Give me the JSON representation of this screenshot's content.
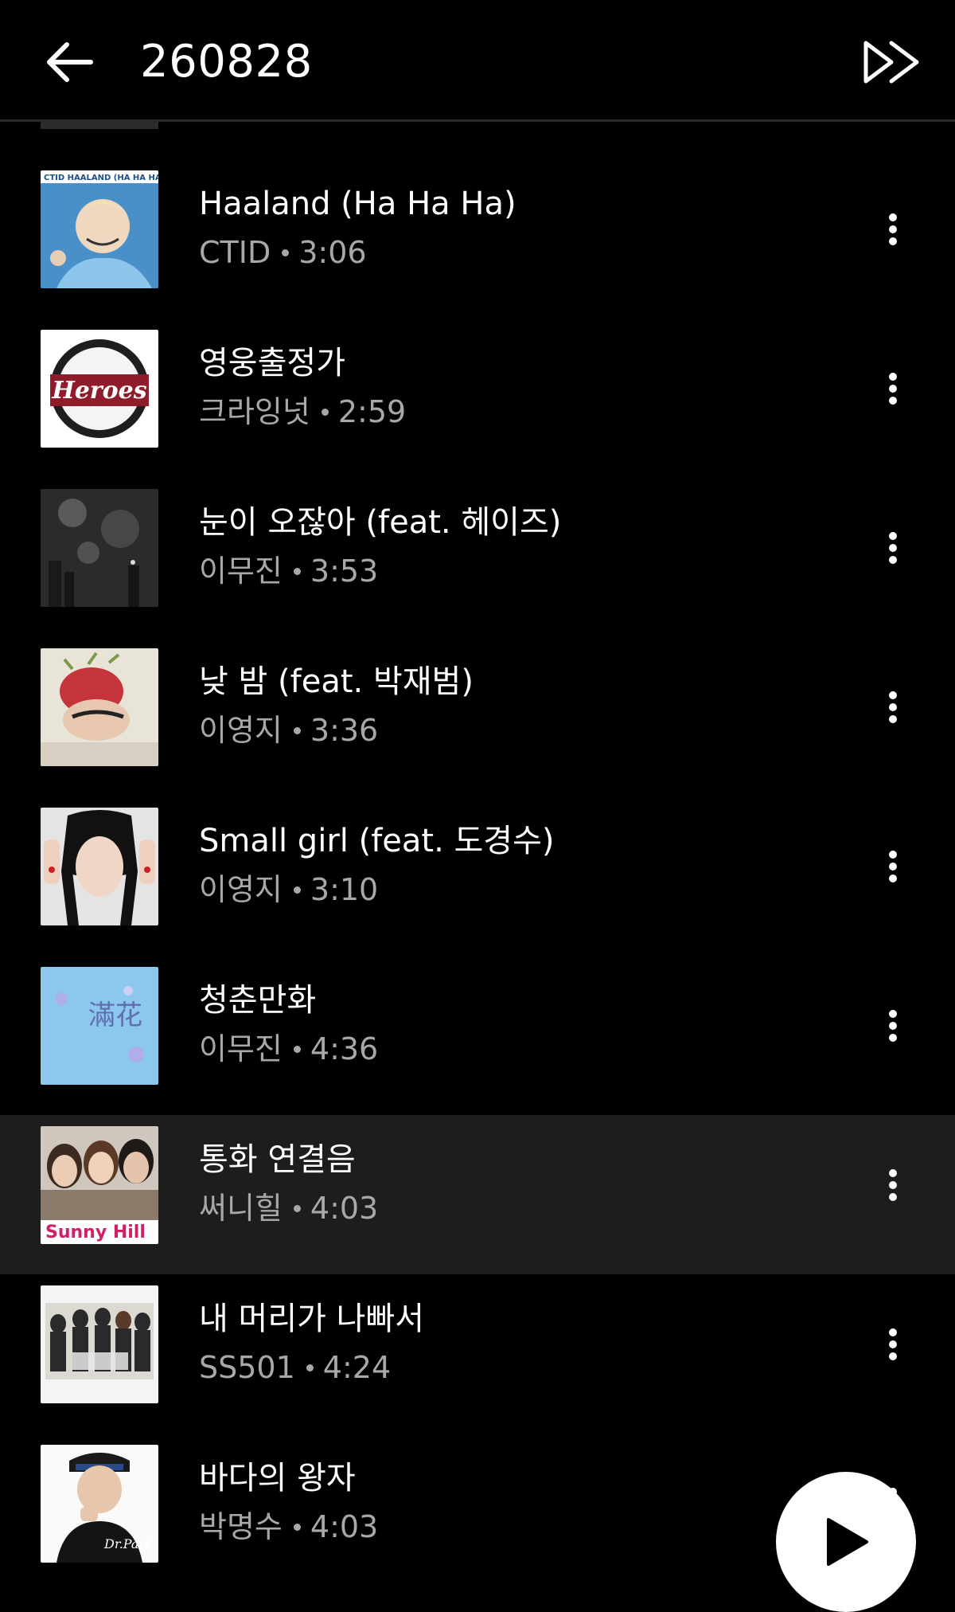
{
  "header": {
    "title": "260828",
    "back_icon": "arrow-left-icon",
    "skip_icon": "double-chevron-right-icon"
  },
  "songs": [
    {
      "title": "Haaland (Ha Ha Ha)",
      "artist": "CTID",
      "duration": "3:06",
      "cover_text": "CTID HAALAND (HA HA HA)"
    },
    {
      "title": "영웅출정가",
      "artist": "크라잉넛",
      "duration": "2:59",
      "cover_text": "Heroes"
    },
    {
      "title": "눈이 오잖아 (feat. 헤이즈)",
      "artist": "이무진",
      "duration": "3:53"
    },
    {
      "title": "낮 밤 (feat. 박재범)",
      "artist": "이영지",
      "duration": "3:36"
    },
    {
      "title": "Small girl (feat. 도경수)",
      "artist": "이영지",
      "duration": "3:10"
    },
    {
      "title": "청춘만화",
      "artist": "이무진",
      "duration": "4:36",
      "cover_text": "滿花"
    },
    {
      "title": "통화 연결음",
      "artist": "써니힐",
      "duration": "4:03",
      "cover_text": "Sunny Hill",
      "highlighted": true
    },
    {
      "title": "내 머리가 나빠서",
      "artist": "SS501",
      "duration": "4:24"
    },
    {
      "title": "바다의 왕자",
      "artist": "박명수",
      "duration": "4:03",
      "cover_text": "Dr.Park"
    }
  ],
  "play_button": {
    "icon": "play-icon"
  },
  "colors": {
    "background": "#000000",
    "highlight_row": "#1d1d1d",
    "secondary_text": "#a8a8a8"
  }
}
